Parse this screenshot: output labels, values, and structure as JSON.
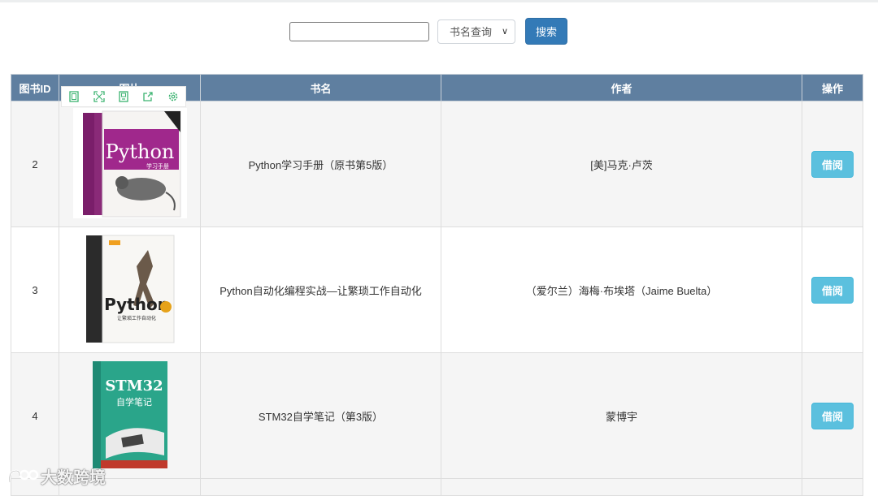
{
  "search": {
    "input_value": "",
    "select_value": "书名查询",
    "button_label": "搜索"
  },
  "table": {
    "headers": [
      "图书ID",
      "图片",
      "书名",
      "作者",
      "操作"
    ],
    "rows": [
      {
        "id": "2",
        "title": "Python学习手册（原书第5版）",
        "author": "[美]马克·卢茨",
        "action": "借阅"
      },
      {
        "id": "3",
        "title": "Python自动化编程实战—让繁琐工作自动化",
        "author": "（爱尔兰）海梅·布埃塔（Jaime Buelta）",
        "action": "借阅"
      },
      {
        "id": "4",
        "title": "STM32自学笔记（第3版）",
        "author": "蒙博宇",
        "action": "借阅"
      }
    ]
  },
  "image_toolbar": {
    "icons": [
      "fit-window-icon",
      "fullscreen-icon",
      "save-image-icon",
      "share-icon",
      "settings-icon"
    ],
    "accent_color": "#3cb371"
  },
  "covers": {
    "cover1_title": "Python",
    "cover1_subtitle": "学习手册",
    "cover2_title": "Python",
    "cover2_subtitle": "让繁琐工作自动化",
    "cover3_title": "STM32",
    "cover3_subtitle": "自学笔记"
  },
  "watermark": {
    "text": "大数跨境"
  },
  "colors": {
    "header_bg": "#5f7fa0",
    "primary_button": "#337ab7",
    "info_button": "#5bc0de"
  }
}
